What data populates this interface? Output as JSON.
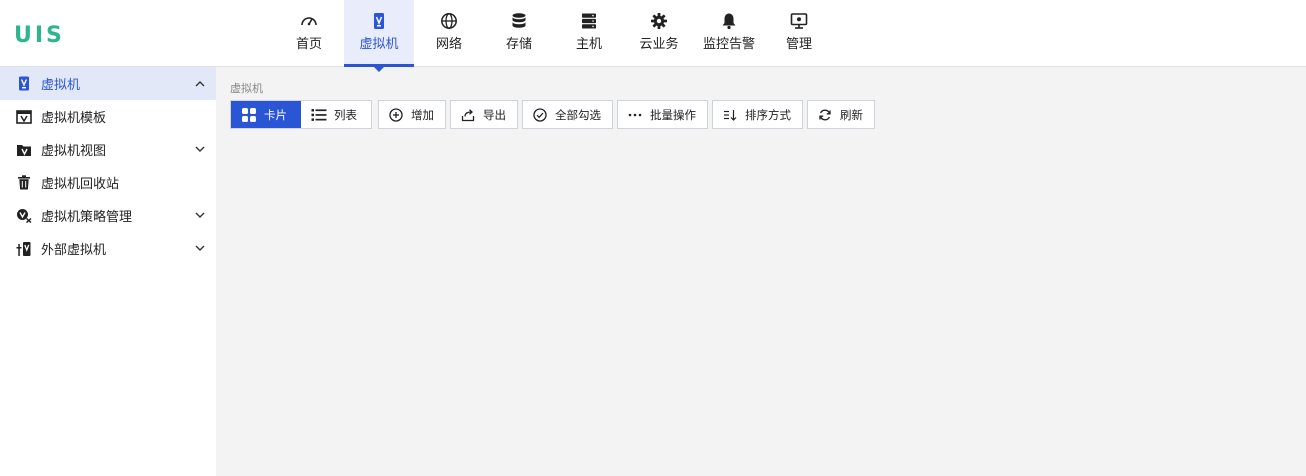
{
  "brand": {
    "logo_text": "UIS",
    "color": "#2db58b"
  },
  "colors": {
    "accent": "#2a55d4"
  },
  "nav": {
    "items": [
      {
        "label": "首页",
        "icon": "dashboard-icon"
      },
      {
        "label": "虚拟机",
        "icon": "vm-icon",
        "active": true
      },
      {
        "label": "网络",
        "icon": "globe-icon"
      },
      {
        "label": "存储",
        "icon": "database-icon"
      },
      {
        "label": "主机",
        "icon": "server-icon"
      },
      {
        "label": "云业务",
        "icon": "gear-icon"
      },
      {
        "label": "监控告警",
        "icon": "bell-icon"
      },
      {
        "label": "管理",
        "icon": "monitor-icon"
      }
    ]
  },
  "sidebar": {
    "items": [
      {
        "label": "虚拟机",
        "icon": "vm-icon",
        "expand": "up"
      },
      {
        "label": "虚拟机模板",
        "icon": "template-icon"
      },
      {
        "label": "虚拟机视图",
        "icon": "folder-icon",
        "expand": "down"
      },
      {
        "label": "虚拟机回收站",
        "icon": "trash-icon"
      },
      {
        "label": "虚拟机策略管理",
        "icon": "policy-icon",
        "expand": "down"
      },
      {
        "label": "外部虚拟机",
        "icon": "external-vm-icon",
        "expand": "down"
      }
    ]
  },
  "breadcrumb": "虚拟机",
  "toolbar": {
    "view_card": "卡片",
    "view_list": "列表",
    "add": "增加",
    "export": "导出",
    "select_all": "全部勾选",
    "batch": "批量操作",
    "sort": "排序方式",
    "refresh": "刷新"
  }
}
